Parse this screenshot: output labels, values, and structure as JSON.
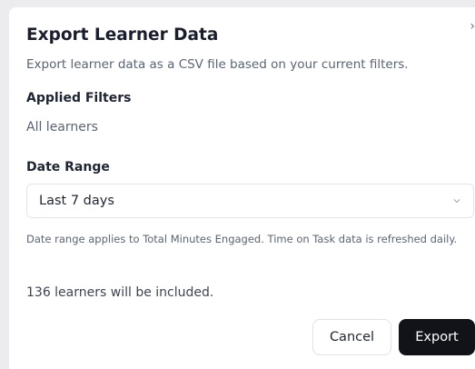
{
  "dialog": {
    "title": "Export Learner Data",
    "subtitle": "Export learner data as a CSV file based on your current filters.",
    "close_icon": "close-icon",
    "applied_filters": {
      "label": "Applied Filters",
      "value": "All learners"
    },
    "date_range": {
      "label": "Date Range",
      "selected": "Last 7 days",
      "icon": "chevron-down-icon"
    },
    "note": "Date range applies to Total Minutes Engaged. Time on Task data is refreshed daily.",
    "count_text": "136 learners will be included.",
    "buttons": {
      "cancel": "Cancel",
      "export": "Export"
    }
  },
  "colors": {
    "primary_button": "#111318",
    "text_dark": "#1a1e2c",
    "text_muted": "#5b6472"
  }
}
